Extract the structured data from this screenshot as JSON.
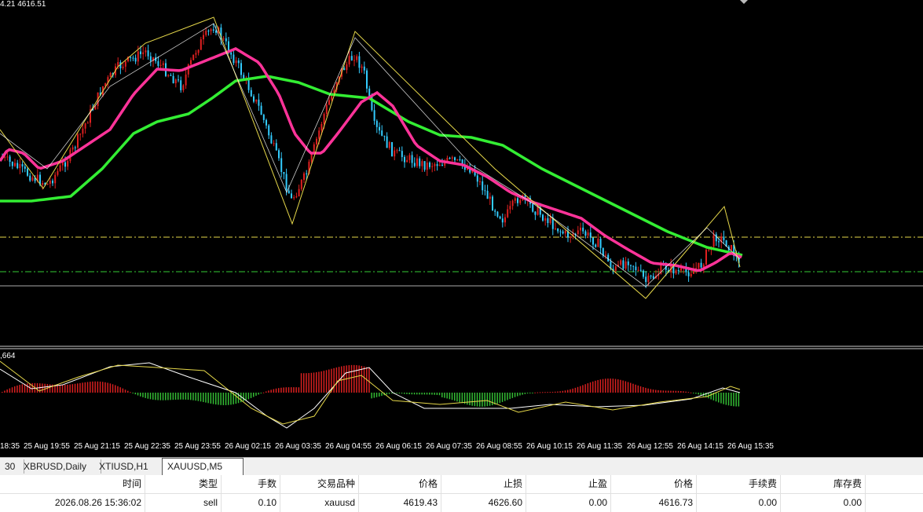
{
  "chart": {
    "ohlc_label": "4.21 4616.51",
    "indicator_label": ",664",
    "colors": {
      "bull": "#e02020",
      "bear": "#33ccff",
      "ma_fast": "#ff3399",
      "ma_slow": "#33ee33",
      "zigzag": "#e6d84a",
      "macd_pos": "#d82020",
      "macd_neg": "#33bb33",
      "level_yellow": "#e6d84a",
      "level_green": "#33cc33",
      "level_gray": "#aaaaaa"
    }
  },
  "time_axis": [
    "18:35",
    "25 Aug 19:55",
    "25 Aug 21:15",
    "25 Aug 22:35",
    "25 Aug 23:55",
    "26 Aug 02:15",
    "26 Aug 03:35",
    "26 Aug 04:55",
    "26 Aug 06:15",
    "26 Aug 07:35",
    "26 Aug 08:55",
    "26 Aug 10:15",
    "26 Aug 11:35",
    "26 Aug 12:55",
    "26 Aug 14:15",
    "26 Aug 15:35"
  ],
  "tabs": [
    {
      "label": "30",
      "active": false
    },
    {
      "label": "XBRUSD,Daily",
      "active": false
    },
    {
      "label": "XTIUSD,H1",
      "active": false
    },
    {
      "label": "XAUUSD,M5",
      "active": true
    }
  ],
  "table": {
    "headers": [
      "时间",
      "类型",
      "手数",
      "交易品种",
      "价格",
      "止损",
      "止盈",
      "价格",
      "手续费",
      "库存费"
    ],
    "row": [
      "2026.08.26 15:36:02",
      "sell",
      "0.10",
      "xauusd",
      "4619.43",
      "4626.60",
      "0.00",
      "4616.73",
      "0.00",
      "0.00"
    ]
  }
}
